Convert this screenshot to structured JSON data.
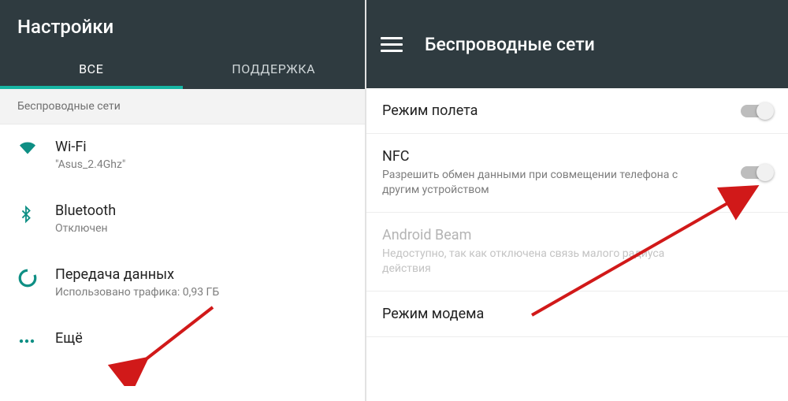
{
  "left": {
    "title": "Настройки",
    "tabs": {
      "all": "ВСЕ",
      "support": "ПОДДЕРЖКА"
    },
    "section_header": "Беспроводные сети",
    "items": {
      "wifi": {
        "label": "Wi-Fi",
        "sub": "\"Asus_2.4Ghz\""
      },
      "bluetooth": {
        "label": "Bluetooth",
        "sub": "Отключен"
      },
      "data": {
        "label": "Передача данных",
        "sub": "Использовано трафика: 0,93 ГБ"
      },
      "more": {
        "label": "Ещё"
      }
    }
  },
  "right": {
    "title": "Беспроводные сети",
    "items": {
      "airplane": {
        "label": "Режим полета"
      },
      "nfc": {
        "label": "NFC",
        "sub": "Разрешить обмен данными при совмещении телефона с другим устройством"
      },
      "beam": {
        "label": "Android Beam",
        "sub": "Недоступно, так как отключена связь малого радиуса действия"
      },
      "tether": {
        "label": "Режим модема"
      }
    }
  }
}
